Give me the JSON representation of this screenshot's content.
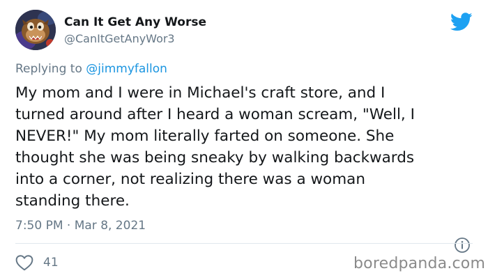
{
  "author": {
    "display_name": "Can It Get Any Worse",
    "handle": "@CanItGetAnyWor3",
    "avatar_icon": "taz-cartoon-avatar"
  },
  "header": {
    "logo_icon": "twitter-bird-icon",
    "logo_color": "#1da1f2"
  },
  "replying": {
    "prefix": "Replying to",
    "mention": "@jimmyfallon"
  },
  "tweet": {
    "lines": [
      "My mom and I were in Michael's craft store, and I",
      "turned around after I heard a woman scream, \"Well, I",
      "NEVER!\" My mom literally farted on someone. She",
      "thought she was being sneaky by walking backwards",
      "into a corner, not realizing there was a woman",
      "standing there."
    ],
    "timestamp": "7:50 PM · Mar 8, 2021"
  },
  "actions": {
    "like_icon": "heart-icon",
    "like_count": "41",
    "info_icon": "info-icon"
  },
  "watermark": {
    "text": "boredpanda.com"
  },
  "colors": {
    "text": "#14171a",
    "secondary": "#657786",
    "link": "#1b95e0",
    "divider": "#e1e8ed"
  }
}
